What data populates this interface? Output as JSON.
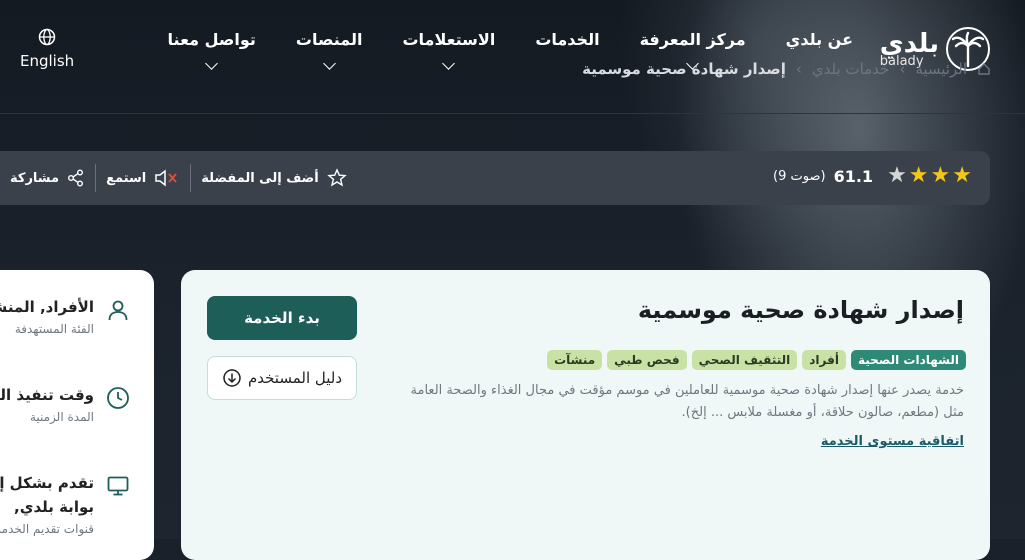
{
  "header": {
    "logo_ar": "بلدي",
    "logo_en": "balady",
    "menu": [
      {
        "label": "عن بلدي"
      },
      {
        "label": "مركز المعرفة"
      },
      {
        "label": "الخدمات"
      },
      {
        "label": "الاستعلامات"
      },
      {
        "label": "المنصات"
      },
      {
        "label": "تواصل معنا"
      }
    ],
    "language": "English"
  },
  "breadcrumb": {
    "items": [
      "الرئيسية",
      "خدمات بلدي",
      "إصدار شهادة صحية موسمية"
    ]
  },
  "toolbar": {
    "rating_value": "61.1",
    "rating_votes": "(9 صوت)",
    "stars_filled": 3,
    "stars_total": 4,
    "favorite_label": "أضف إلى المفضلة",
    "listen_label": "استمع",
    "share_label": "مشاركة"
  },
  "service": {
    "title": "إصدار شهادة صحية موسمية",
    "tags": [
      "الشهادات الصحية",
      "أفراد",
      "التثقيف الصحي",
      "فحص طبي",
      "منشآت"
    ],
    "description": "خدمة يصدر عنها إصدار شهادة صحية موسمية للعاملين في موسم مؤقت في مجال الغذاء والصحة العامة مثل (مطعم، صالون حلاقة، أو مغسلة ملابس ... إلخ).",
    "sla_link": "اتفاقية مستوى الخدمة",
    "start_button": "بدء الخدمة",
    "guide_button": "دليل المستخدم"
  },
  "side": {
    "beneficiaries_title": "الأفراد, المنشآت",
    "beneficiaries_sub": "الفئة المستهدفة",
    "duration_title": "وقت تنفيذ الخدمة",
    "duration_sub": "المدة الزمنية",
    "channel_title": "تقدم بشكل إلكتروني",
    "channel_sub": "بوابة بلدي,",
    "channel_sub2": "قنوات تقديم الخدمة"
  },
  "colors": {
    "accent": "#1d5e59",
    "tag_primary": "#2e8a76",
    "tag_secondary": "#c8e2a6",
    "star": "#f5c518"
  }
}
